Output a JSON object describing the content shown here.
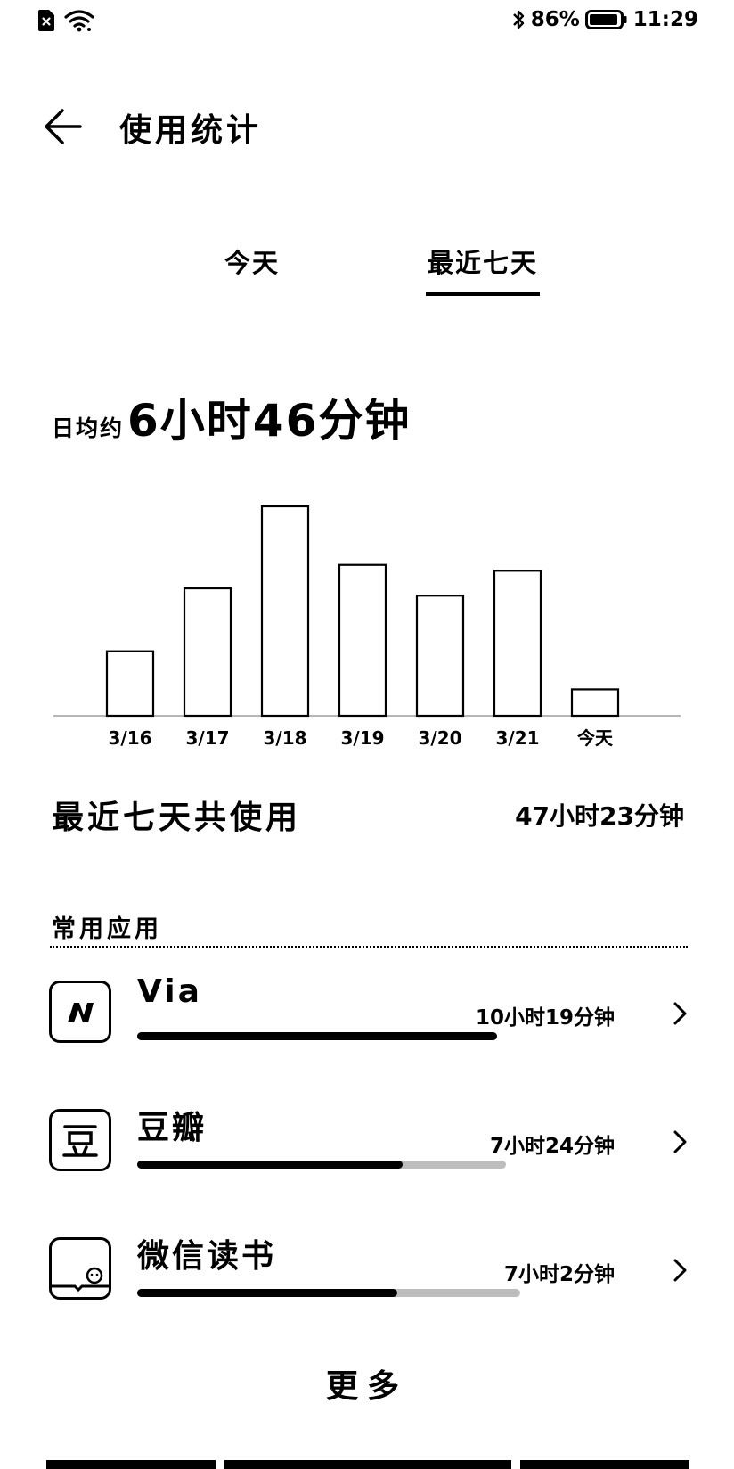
{
  "status": {
    "battery": "86%",
    "time": "11:29"
  },
  "header": {
    "title": "使用统计"
  },
  "tabs": [
    {
      "label": "今天",
      "active": false
    },
    {
      "label": "最近七天",
      "active": true
    }
  ],
  "summary": {
    "avg_prefix": "日均约",
    "avg_value": "6小时46分钟",
    "total_label": "最近七天共使用",
    "total_value": "47小时23分钟"
  },
  "chart_data": {
    "type": "bar",
    "categories": [
      "3/16",
      "3/17",
      "3/18",
      "3/19",
      "3/20",
      "3/21",
      "今天"
    ],
    "values": [
      4.4,
      8.7,
      14.3,
      10.3,
      8.2,
      9.9,
      1.8
    ],
    "units": "hours",
    "ylim": [
      0,
      14.3
    ],
    "grid": false,
    "legend": "none",
    "title": "",
    "xlabel": "",
    "ylabel": ""
  },
  "apps": {
    "section_title": "常用应用",
    "items": [
      {
        "name": "Via",
        "time": "10小时19分钟",
        "fraction": 1.0,
        "icon": "via-icon"
      },
      {
        "name": "豆瓣",
        "time": "7小时24分钟",
        "fraction": 0.72,
        "icon": "douban-icon"
      },
      {
        "name": "微信读书",
        "time": "7小时2分钟",
        "fraction": 0.68,
        "icon": "weread-icon"
      }
    ]
  },
  "more_label": "更多",
  "colors": {
    "foreground": "#000000",
    "background": "#ffffff",
    "bar_track": "#bdbdbd"
  }
}
